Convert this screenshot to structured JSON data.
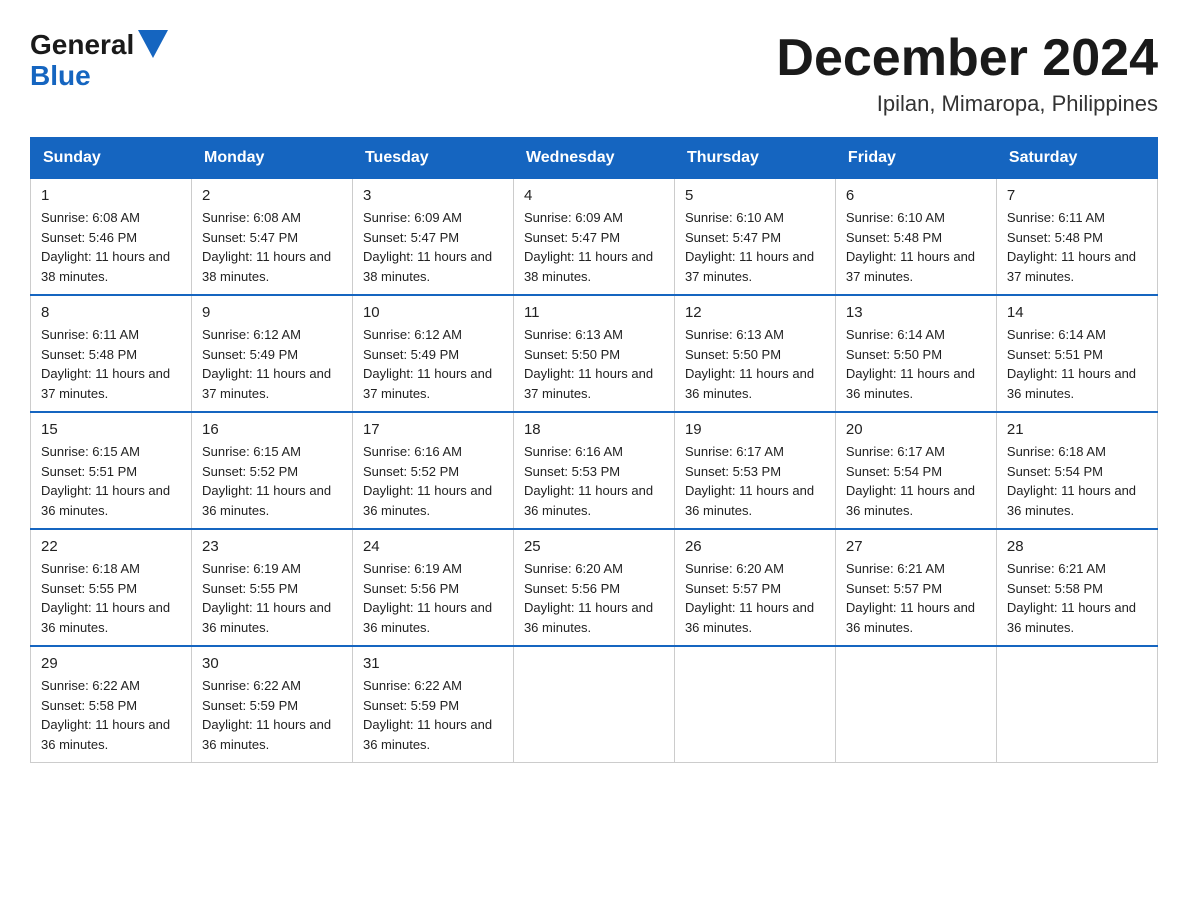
{
  "header": {
    "logo_general": "General",
    "logo_blue": "Blue",
    "month_title": "December 2024",
    "location": "Ipilan, Mimaropa, Philippines"
  },
  "days_of_week": [
    "Sunday",
    "Monday",
    "Tuesday",
    "Wednesday",
    "Thursday",
    "Friday",
    "Saturday"
  ],
  "weeks": [
    [
      {
        "day": "1",
        "sunrise": "6:08 AM",
        "sunset": "5:46 PM",
        "daylight": "11 hours and 38 minutes."
      },
      {
        "day": "2",
        "sunrise": "6:08 AM",
        "sunset": "5:47 PM",
        "daylight": "11 hours and 38 minutes."
      },
      {
        "day": "3",
        "sunrise": "6:09 AM",
        "sunset": "5:47 PM",
        "daylight": "11 hours and 38 minutes."
      },
      {
        "day": "4",
        "sunrise": "6:09 AM",
        "sunset": "5:47 PM",
        "daylight": "11 hours and 38 minutes."
      },
      {
        "day": "5",
        "sunrise": "6:10 AM",
        "sunset": "5:47 PM",
        "daylight": "11 hours and 37 minutes."
      },
      {
        "day": "6",
        "sunrise": "6:10 AM",
        "sunset": "5:48 PM",
        "daylight": "11 hours and 37 minutes."
      },
      {
        "day": "7",
        "sunrise": "6:11 AM",
        "sunset": "5:48 PM",
        "daylight": "11 hours and 37 minutes."
      }
    ],
    [
      {
        "day": "8",
        "sunrise": "6:11 AM",
        "sunset": "5:48 PM",
        "daylight": "11 hours and 37 minutes."
      },
      {
        "day": "9",
        "sunrise": "6:12 AM",
        "sunset": "5:49 PM",
        "daylight": "11 hours and 37 minutes."
      },
      {
        "day": "10",
        "sunrise": "6:12 AM",
        "sunset": "5:49 PM",
        "daylight": "11 hours and 37 minutes."
      },
      {
        "day": "11",
        "sunrise": "6:13 AM",
        "sunset": "5:50 PM",
        "daylight": "11 hours and 37 minutes."
      },
      {
        "day": "12",
        "sunrise": "6:13 AM",
        "sunset": "5:50 PM",
        "daylight": "11 hours and 36 minutes."
      },
      {
        "day": "13",
        "sunrise": "6:14 AM",
        "sunset": "5:50 PM",
        "daylight": "11 hours and 36 minutes."
      },
      {
        "day": "14",
        "sunrise": "6:14 AM",
        "sunset": "5:51 PM",
        "daylight": "11 hours and 36 minutes."
      }
    ],
    [
      {
        "day": "15",
        "sunrise": "6:15 AM",
        "sunset": "5:51 PM",
        "daylight": "11 hours and 36 minutes."
      },
      {
        "day": "16",
        "sunrise": "6:15 AM",
        "sunset": "5:52 PM",
        "daylight": "11 hours and 36 minutes."
      },
      {
        "day": "17",
        "sunrise": "6:16 AM",
        "sunset": "5:52 PM",
        "daylight": "11 hours and 36 minutes."
      },
      {
        "day": "18",
        "sunrise": "6:16 AM",
        "sunset": "5:53 PM",
        "daylight": "11 hours and 36 minutes."
      },
      {
        "day": "19",
        "sunrise": "6:17 AM",
        "sunset": "5:53 PM",
        "daylight": "11 hours and 36 minutes."
      },
      {
        "day": "20",
        "sunrise": "6:17 AM",
        "sunset": "5:54 PM",
        "daylight": "11 hours and 36 minutes."
      },
      {
        "day": "21",
        "sunrise": "6:18 AM",
        "sunset": "5:54 PM",
        "daylight": "11 hours and 36 minutes."
      }
    ],
    [
      {
        "day": "22",
        "sunrise": "6:18 AM",
        "sunset": "5:55 PM",
        "daylight": "11 hours and 36 minutes."
      },
      {
        "day": "23",
        "sunrise": "6:19 AM",
        "sunset": "5:55 PM",
        "daylight": "11 hours and 36 minutes."
      },
      {
        "day": "24",
        "sunrise": "6:19 AM",
        "sunset": "5:56 PM",
        "daylight": "11 hours and 36 minutes."
      },
      {
        "day": "25",
        "sunrise": "6:20 AM",
        "sunset": "5:56 PM",
        "daylight": "11 hours and 36 minutes."
      },
      {
        "day": "26",
        "sunrise": "6:20 AM",
        "sunset": "5:57 PM",
        "daylight": "11 hours and 36 minutes."
      },
      {
        "day": "27",
        "sunrise": "6:21 AM",
        "sunset": "5:57 PM",
        "daylight": "11 hours and 36 minutes."
      },
      {
        "day": "28",
        "sunrise": "6:21 AM",
        "sunset": "5:58 PM",
        "daylight": "11 hours and 36 minutes."
      }
    ],
    [
      {
        "day": "29",
        "sunrise": "6:22 AM",
        "sunset": "5:58 PM",
        "daylight": "11 hours and 36 minutes."
      },
      {
        "day": "30",
        "sunrise": "6:22 AM",
        "sunset": "5:59 PM",
        "daylight": "11 hours and 36 minutes."
      },
      {
        "day": "31",
        "sunrise": "6:22 AM",
        "sunset": "5:59 PM",
        "daylight": "11 hours and 36 minutes."
      },
      null,
      null,
      null,
      null
    ]
  ]
}
